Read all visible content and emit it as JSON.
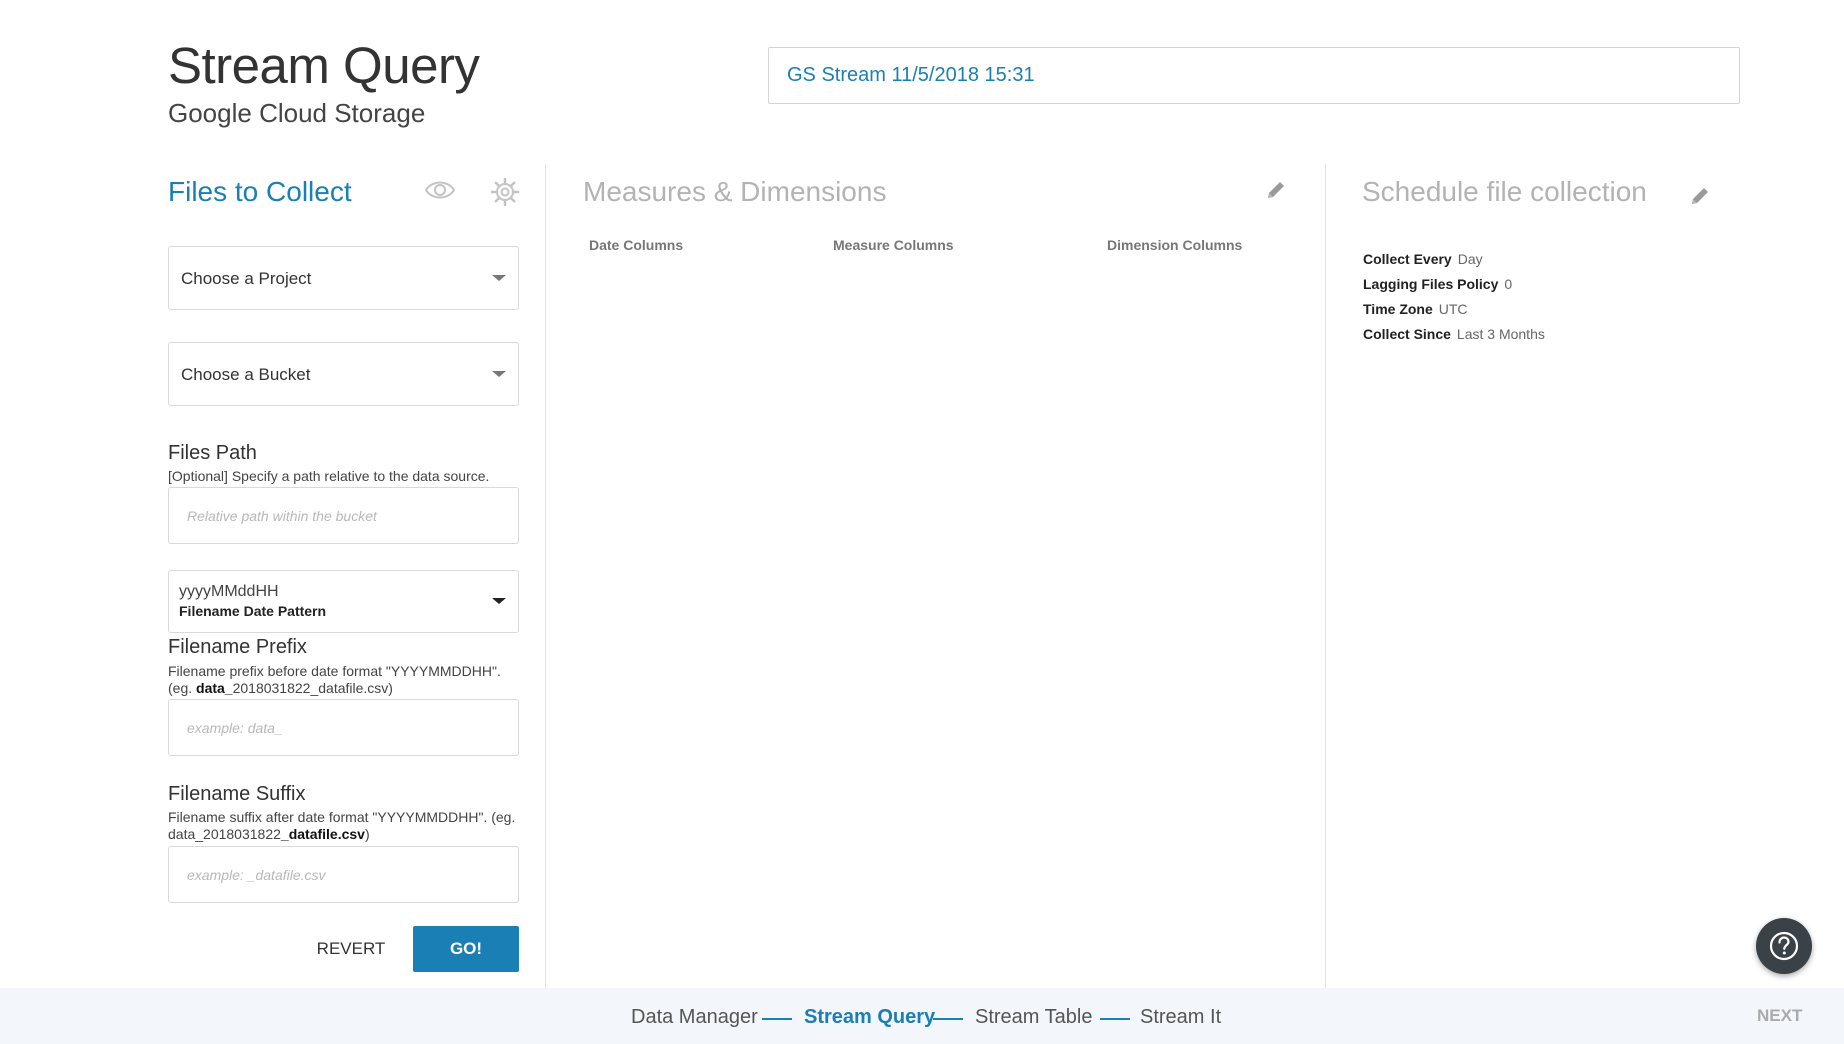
{
  "header": {
    "title": "Stream Query",
    "subtitle": "Google Cloud Storage",
    "stream_name": "GS Stream 11/5/2018 15:31"
  },
  "files_panel": {
    "title": "Files to Collect",
    "icons": [
      "eye-icon",
      "gear-icon"
    ],
    "project_select": "Choose a Project",
    "bucket_select": "Choose a Bucket",
    "files_path": {
      "label": "Files Path",
      "help": "[Optional] Specify a path relative to the data source.",
      "placeholder": "Relative path within the bucket",
      "value": ""
    },
    "date_pattern": {
      "value": "yyyyMMddHH",
      "label": "Filename Date Pattern"
    },
    "prefix": {
      "label": "Filename Prefix",
      "help_before": "Filename prefix before date format \"YYYYMMDDHH\". (eg. ",
      "help_bold": "data_",
      "help_after": "2018031822_datafile.csv)",
      "placeholder": "example: data_",
      "value": ""
    },
    "suffix": {
      "label": "Filename Suffix",
      "help_before": "Filename suffix after date format \"YYYYMMDDHH\". (eg. data_2018031822",
      "help_bold": "_datafile.csv",
      "help_after": ")",
      "placeholder": "example: _datafile.csv",
      "value": ""
    },
    "revert_label": "REVERT",
    "go_label": "GO!"
  },
  "measures_panel": {
    "title": "Measures & Dimensions",
    "columns": [
      "Date Columns",
      "Measure Columns",
      "Dimension Columns"
    ]
  },
  "schedule_panel": {
    "title": "Schedule file collection",
    "rows": [
      {
        "label": "Collect Every",
        "value": "Day"
      },
      {
        "label": "Lagging Files Policy",
        "value": "0"
      },
      {
        "label": "Time Zone",
        "value": "UTC"
      },
      {
        "label": "Collect Since",
        "value": "Last 3 Months"
      }
    ]
  },
  "footer": {
    "steps": [
      "Data Manager",
      "Stream Query",
      "Stream Table",
      "Stream It"
    ],
    "current_step": "Stream Query",
    "next_label": "NEXT"
  },
  "colors": {
    "accent": "#1a7fb5",
    "muted_title": "#b3b3b3",
    "footer_bg": "#f3f6fa",
    "fab_bg": "#3a4147"
  }
}
